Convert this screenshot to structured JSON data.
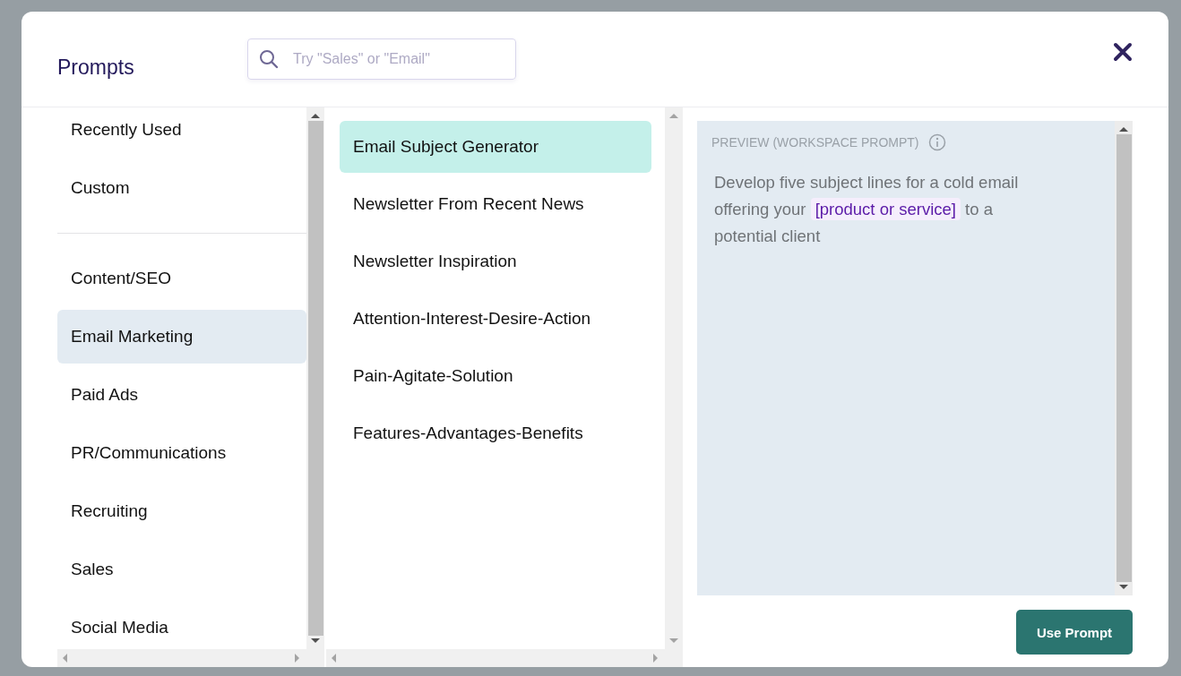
{
  "dialog": {
    "title": "Prompts"
  },
  "search": {
    "placeholder": "Try \"Sales\" or \"Email\""
  },
  "categories": [
    [
      {
        "label": "Recently Used",
        "selected": false
      },
      {
        "label": "Custom",
        "selected": false
      }
    ],
    [
      {
        "label": "Content/SEO",
        "selected": false
      },
      {
        "label": "Email Marketing",
        "selected": true
      },
      {
        "label": "Paid Ads",
        "selected": false
      },
      {
        "label": "PR/Communications",
        "selected": false
      },
      {
        "label": "Recruiting",
        "selected": false
      },
      {
        "label": "Sales",
        "selected": false
      },
      {
        "label": "Social Media",
        "selected": false
      }
    ]
  ],
  "prompts": [
    {
      "label": "Email Subject Generator",
      "selected": true
    },
    {
      "label": "Newsletter From Recent News",
      "selected": false
    },
    {
      "label": "Newsletter Inspiration",
      "selected": false
    },
    {
      "label": "Attention-Interest-Desire-Action",
      "selected": false
    },
    {
      "label": "Pain-Agitate-Solution",
      "selected": false
    },
    {
      "label": "Features-Advantages-Benefits",
      "selected": false
    }
  ],
  "preview": {
    "heading": "PREVIEW (WORKSPACE PROMPT)",
    "parts": [
      {
        "kind": "plain",
        "text": "Develop five subject lines for a cold email offering your "
      },
      {
        "kind": "variable",
        "text": "[product or service]"
      },
      {
        "kind": "plain",
        "text": " to a potential client"
      }
    ]
  },
  "use_button": "Use Prompt"
}
